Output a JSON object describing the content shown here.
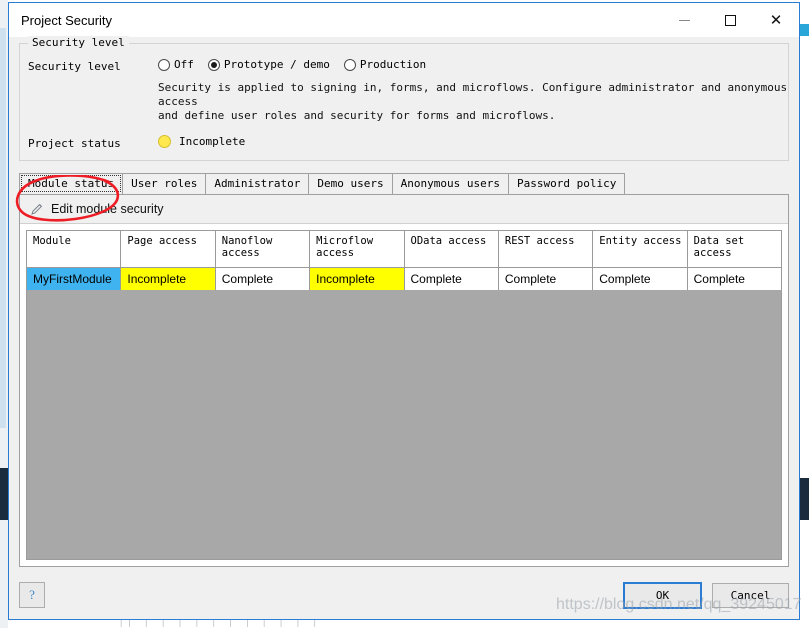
{
  "window": {
    "title": "Project Security",
    "controls": {
      "minimize": "minimize-icon",
      "maximize": "maximize-icon",
      "close": "close-icon"
    }
  },
  "security_level_group": {
    "legend": "Security level",
    "field_label": "Security level",
    "options": [
      {
        "label": "Off",
        "selected": false
      },
      {
        "label": "Prototype / demo",
        "selected": true
      },
      {
        "label": "Production",
        "selected": false
      }
    ],
    "description_line1": "Security is applied to signing in, forms, and microflows. Configure administrator and anonymous access",
    "description_line2": "and define user roles and security for forms and microflows.",
    "project_status_label": "Project status",
    "project_status_value": "Incomplete",
    "project_status_color": "#ffe94f"
  },
  "tabs": [
    {
      "label": "Module status",
      "active": true
    },
    {
      "label": "User roles",
      "active": false
    },
    {
      "label": "Administrator",
      "active": false
    },
    {
      "label": "Demo users",
      "active": false
    },
    {
      "label": "Anonymous users",
      "active": false
    },
    {
      "label": "Password policy",
      "active": false
    }
  ],
  "toolbar": {
    "icon": "pencil-icon",
    "label": "Edit module security"
  },
  "table": {
    "columns": [
      "Module",
      "Page access",
      "Nanoflow access",
      "Microflow access",
      "OData access",
      "REST access",
      "Entity access",
      "Data set access"
    ],
    "rows": [
      {
        "module": "MyFirstModule",
        "cells": [
          {
            "value": "Incomplete",
            "state": "incomplete"
          },
          {
            "value": "Complete",
            "state": "complete"
          },
          {
            "value": "Incomplete",
            "state": "incomplete"
          },
          {
            "value": "Complete",
            "state": "complete"
          },
          {
            "value": "Complete",
            "state": "complete"
          },
          {
            "value": "Complete",
            "state": "complete"
          },
          {
            "value": "Complete",
            "state": "complete"
          }
        ]
      }
    ]
  },
  "footer": {
    "help_label": "?",
    "ok_label": "OK",
    "cancel_label": "Cancel"
  },
  "annotation": {
    "type": "hand-drawn-red-circle",
    "color": "#ee1c25",
    "target": "Module status"
  },
  "watermark": {
    "text": "https://blog.csdn.net/qq_39245017"
  },
  "background": {
    "bottom_text": "|| | | | | | | | | | | |"
  },
  "colors": {
    "accent": "#2b7cd3",
    "selected_row": "#3fb3ef",
    "warning": "#ffff00",
    "filler": "#a8a8a8"
  }
}
